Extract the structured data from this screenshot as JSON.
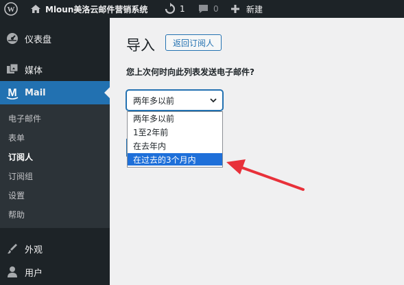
{
  "adminbar": {
    "site_name": "Mloun美洛云邮件营销系统",
    "updates_count": "1",
    "comments_count": "0",
    "new_label": "新建"
  },
  "sidebar": {
    "dashboard": "仪表盘",
    "media": "媒体",
    "mail": "Mail",
    "submenu": [
      "电子邮件",
      "表单",
      "订阅人",
      "订阅组",
      "设置",
      "帮助"
    ],
    "appearance": "外观",
    "users": "用户"
  },
  "main": {
    "title": "导入",
    "back_button": "返回订阅人",
    "question": "您上次何时向此列表发送电子邮件?",
    "select_value": "两年多以前",
    "options": [
      "两年多以前",
      "1至2年前",
      "在去年内",
      "在过去的3个月内"
    ]
  },
  "colors": {
    "adminbar_bg": "#1d2327",
    "accent": "#2271b1",
    "option_highlight": "#1e6fd9",
    "annotation_arrow": "#e8313a"
  },
  "icons": [
    "wordpress-logo-icon",
    "home-icon",
    "updates-icon",
    "comment-icon",
    "plus-icon",
    "dashboard-icon",
    "media-icon",
    "mail-icon",
    "appearance-icon",
    "users-icon",
    "chevron-down-icon"
  ]
}
